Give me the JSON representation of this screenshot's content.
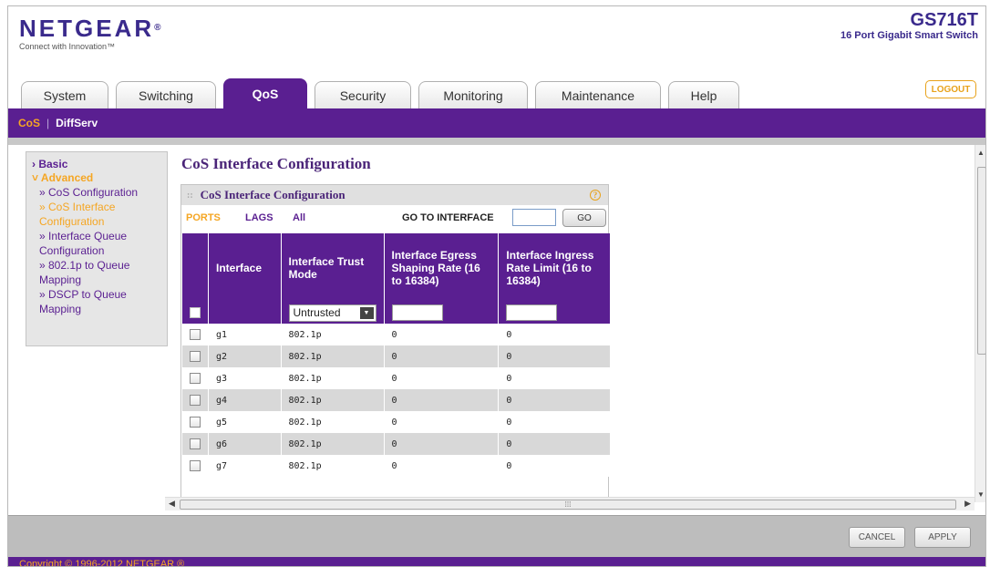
{
  "header": {
    "logo": "NETGEAR",
    "logo_mark": "®",
    "tagline": "Connect with Innovation™",
    "model_name": "GS716T",
    "model_desc": "16 Port Gigabit Smart Switch",
    "logout_label": "LOGOUT"
  },
  "tabs": [
    {
      "label": "System"
    },
    {
      "label": "Switching"
    },
    {
      "label": "QoS"
    },
    {
      "label": "Security"
    },
    {
      "label": "Monitoring"
    },
    {
      "label": "Maintenance"
    },
    {
      "label": "Help"
    }
  ],
  "active_tab": "QoS",
  "subnav": {
    "items": [
      "CoS",
      "DiffServ"
    ],
    "separator": "|"
  },
  "leftnav": {
    "basic": "Basic",
    "advanced": "Advanced",
    "items": [
      {
        "label": "CoS Configuration",
        "active": false
      },
      {
        "label": "CoS Interface Configuration",
        "active": true
      },
      {
        "label": "Interface Queue Configuration",
        "active": false
      },
      {
        "label": "802.1p to Queue Mapping",
        "active": false
      },
      {
        "label": "DSCP to Queue Mapping",
        "active": false
      }
    ],
    "item_labels": {
      "cos_config": "» CoS Configuration",
      "cos_if_1": "» CoS Interface",
      "cos_if_2": "Configuration",
      "if_queue_1": "» Interface Queue",
      "if_queue_2": "Configuration",
      "dot1p_1": "» 802.1p to Queue",
      "dot1p_2": "Mapping",
      "dscp_1": "» DSCP to Queue",
      "dscp_2": "Mapping"
    }
  },
  "page_title": "CoS Interface Configuration",
  "panel": {
    "title": "CoS Interface Configuration",
    "help": "?",
    "ports_label": "PORTS",
    "lags_label": "LAGS",
    "all_label": "All",
    "goto_label": "GO TO INTERFACE",
    "go_label": "GO"
  },
  "table": {
    "headers": {
      "interface": "Interface",
      "trust_mode": "Interface Trust Mode",
      "egress": "Interface Egress Shaping Rate (16 to 16384)",
      "ingress": "Interface Ingress Rate Limit (16 to 16384)"
    },
    "filter_trust_value": "Untrusted",
    "rows": [
      {
        "interface": "g1",
        "trust": "802.1p",
        "egress": "0",
        "ingress": "0"
      },
      {
        "interface": "g2",
        "trust": "802.1p",
        "egress": "0",
        "ingress": "0"
      },
      {
        "interface": "g3",
        "trust": "802.1p",
        "egress": "0",
        "ingress": "0"
      },
      {
        "interface": "g4",
        "trust": "802.1p",
        "egress": "0",
        "ingress": "0"
      },
      {
        "interface": "g5",
        "trust": "802.1p",
        "egress": "0",
        "ingress": "0"
      },
      {
        "interface": "g6",
        "trust": "802.1p",
        "egress": "0",
        "ingress": "0"
      },
      {
        "interface": "g7",
        "trust": "802.1p",
        "egress": "0",
        "ingress": "0"
      }
    ]
  },
  "buttons": {
    "cancel": "CANCEL",
    "apply": "APPLY"
  },
  "footer": {
    "copyright": "Copyright © 1996-2012 NETGEAR ®"
  },
  "colors": {
    "brand_purple": "#5a1f91",
    "accent_orange": "#f5a623"
  }
}
